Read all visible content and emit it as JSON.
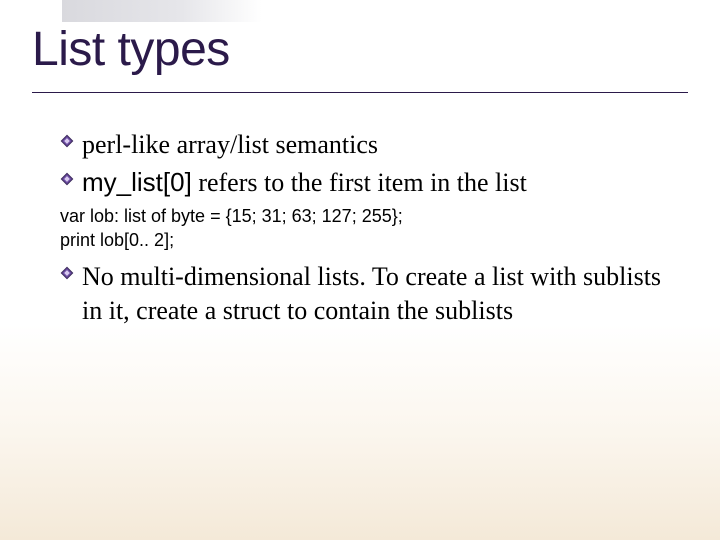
{
  "title": "List types",
  "bullets": [
    {
      "prefix": "",
      "text": "perl-like array/list semantics"
    },
    {
      "prefix": "my_list[0]",
      "text": " refers to the first item in the list"
    }
  ],
  "code": [
    "var lob: list of byte = {15; 31; 63; 127; 255};",
    "print lob[0.. 2];"
  ],
  "bullet_after": "No multi-dimensional lists. To create a list with sublists in it, create a struct to contain the sublists"
}
